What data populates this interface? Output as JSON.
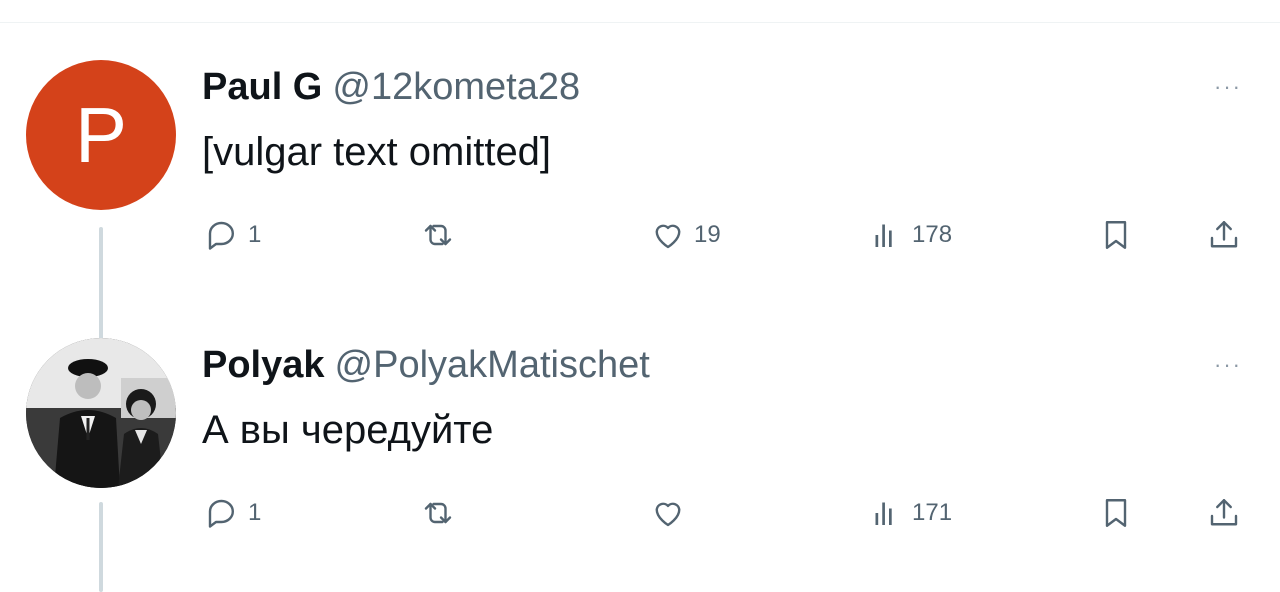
{
  "colors": {
    "avatar_bg": "#d4421a",
    "handle": "#536471",
    "text": "#0f1419",
    "thread_line": "#cfd9de"
  },
  "tweets": [
    {
      "avatar_letter": "P",
      "name": "Paul G",
      "handle": "@12kometa28",
      "more": "···",
      "text": "[vulgar text omitted]",
      "replies": "1",
      "retweets": "",
      "likes": "19",
      "views": "178"
    },
    {
      "avatar_letter": "",
      "name": "Polyak",
      "handle": "@PolyakMatischet",
      "more": "···",
      "text": "А вы чередуйте",
      "replies": "1",
      "retweets": "",
      "likes": "",
      "views": "171"
    }
  ]
}
